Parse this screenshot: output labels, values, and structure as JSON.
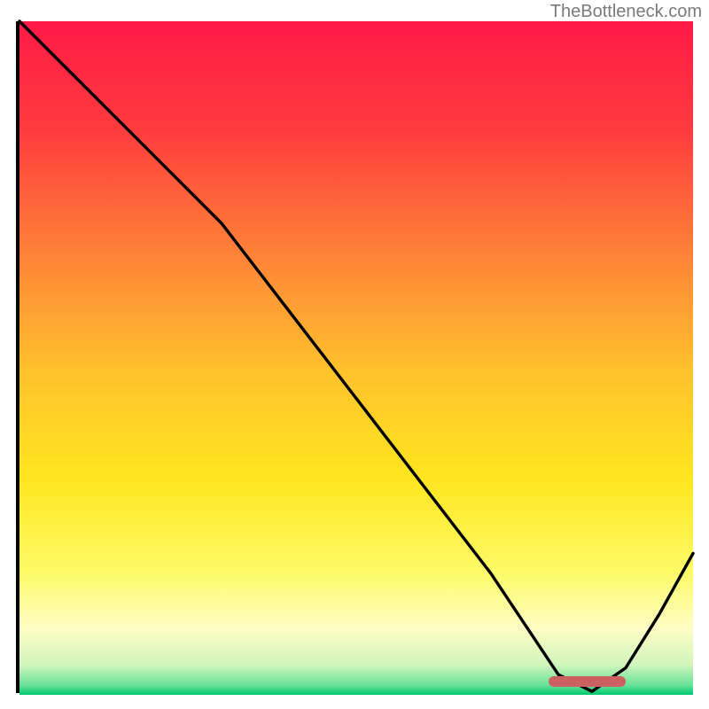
{
  "attribution": "TheBottleneck.com",
  "colors": {
    "axis": "#000000",
    "curve": "#000000",
    "marker": "#cb6160",
    "gradient_top": "#ff1a46",
    "gradient_bottom": "#00c96f"
  },
  "chart_data": {
    "type": "line",
    "title": "",
    "xlabel": "",
    "ylabel": "",
    "xlim": [
      0,
      100
    ],
    "ylim": [
      0,
      100
    ],
    "grid": false,
    "legend": false,
    "series": [
      {
        "name": "bottleneck-curve",
        "x": [
          0,
          10,
          22,
          30,
          40,
          50,
          60,
          70,
          76,
          80,
          85,
          90,
          95,
          100
        ],
        "y": [
          100,
          90,
          78,
          70,
          57,
          44,
          31,
          18,
          9,
          3,
          0.5,
          4,
          12,
          21
        ]
      }
    ],
    "annotations": [
      {
        "name": "optimal-range",
        "x_start": 78.5,
        "x_end": 90,
        "y": 1.2
      }
    ]
  }
}
